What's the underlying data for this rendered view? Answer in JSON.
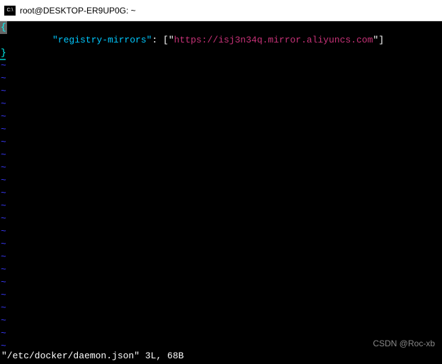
{
  "window": {
    "title": "root@DESKTOP-ER9UP0G: ~"
  },
  "editor": {
    "brace_open": "{",
    "brace_close": "}",
    "tilde": "~",
    "key_text": "\"registry-mirrors\"",
    "colon_text": ": ",
    "bracket_open": "[",
    "quote": "\"",
    "url_text": "https://isj3n34q.mirror.aliyuncs.com",
    "bracket_close": "]"
  },
  "status": {
    "text": "\"/etc/docker/daemon.json\" 3L, 68B"
  },
  "watermark": {
    "text": "CSDN @Roc-xb"
  }
}
